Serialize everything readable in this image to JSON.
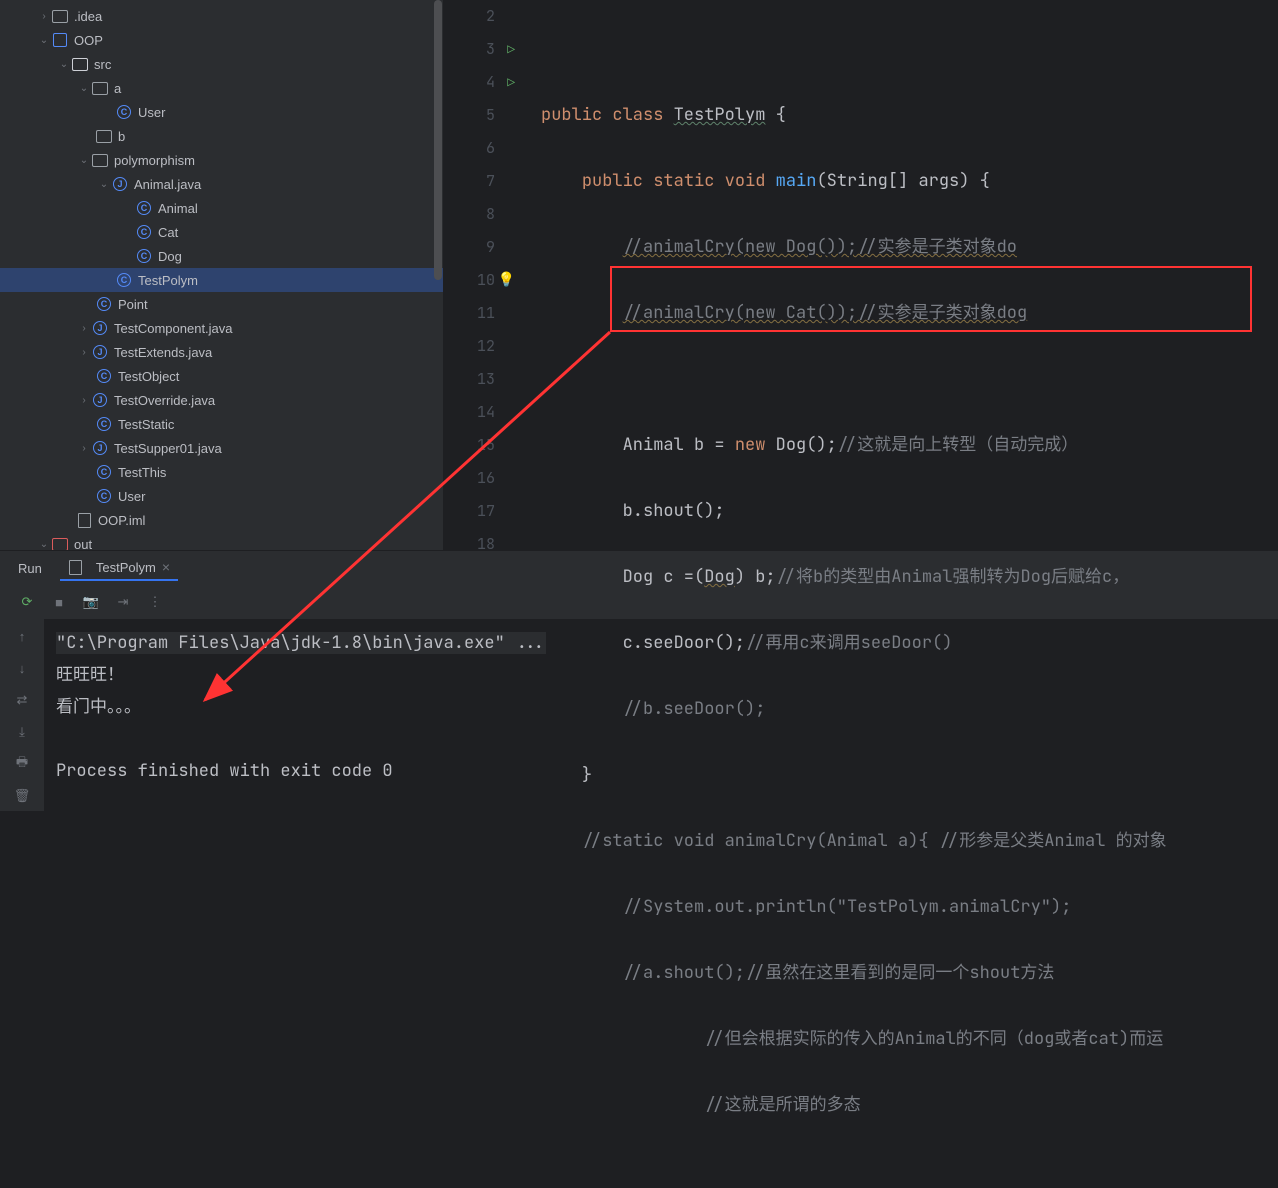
{
  "tree": {
    "idea": ".idea",
    "oop": "OOP",
    "src": "src",
    "pkg_a": "a",
    "user": "User",
    "pkg_b": "b",
    "polymorphism": "polymorphism",
    "animal_java": "Animal.java",
    "animal": "Animal",
    "cat": "Cat",
    "dog": "Dog",
    "testpolym": "TestPolym",
    "point": "Point",
    "testcomponent": "TestComponent.java",
    "testextends": "TestExtends.java",
    "testobject": "TestObject",
    "testoverride": "TestOverride.java",
    "teststatic": "TestStatic",
    "testsupper": "TestSupper01.java",
    "testthis": "TestThis",
    "user2": "User",
    "oop_iml": "OOP.iml",
    "out": "out"
  },
  "line_numbers": [
    "2",
    "3",
    "4",
    "5",
    "6",
    "7",
    "8",
    "9",
    "10",
    "11",
    "12",
    "13",
    "14",
    "15",
    "16",
    "17",
    "18"
  ],
  "code": {
    "l2": "",
    "l3_kw1": "public",
    "l3_kw2": "class",
    "l3_cls": "TestPolym",
    "l3_brace": " {",
    "l4_kw1": "public",
    "l4_kw2": "static",
    "l4_kw3": "void",
    "l4_fn": "main",
    "l4_args": "(String[] args) {",
    "l5_cmt": "//animalCry(new Dog());//实参是子类对象do",
    "l6_cmt": "//animalCry(new Cat());//实参是子类对象dog",
    "l8_txt1": "Animal b = ",
    "l8_kw": "new",
    "l8_txt2": " Dog();",
    "l8_cmt": "//这就是向上转型（自动完成）",
    "l9_txt": "b.shout();",
    "l10_txt1": "Dog c =(",
    "l10_cls": "Dog",
    "l10_txt2": ") b;",
    "l10_cmt": "//将b的类型由Animal强制转为Dog后赋给c，",
    "l11_txt": "c.seeDoor();",
    "l11_cmt": "//再用c来调用seeDoor()",
    "l12_cmt": "//b.seeDoor();",
    "l13_brace": "}",
    "l14_cmt": "//static void animalCry(Animal a){ //形参是父类Animal 的对象",
    "l15_cmt": "//System.out.println(\"TestPolym.animalCry\");",
    "l16_cmt": "//a.shout();//虽然在这里看到的是同一个shout方法",
    "l17_cmt": "//但会根据实际的传入的Animal的不同（dog或者cat)而运",
    "l18_cmt": "//这就是所谓的多态"
  },
  "run": {
    "label": "Run",
    "tab": "TestPolym",
    "cmd": "\"C:\\Program Files\\Java\\jdk-1.8\\bin\\java.exe\" ...",
    "out1": "旺旺旺！",
    "out2": "看门中。。。",
    "exit": "Process finished with exit code 0"
  }
}
